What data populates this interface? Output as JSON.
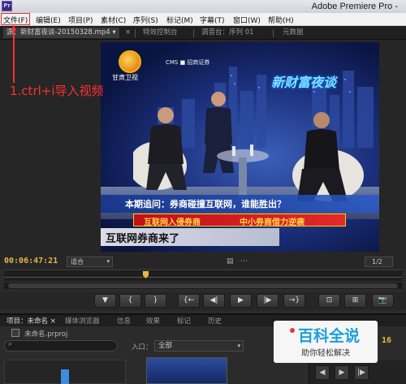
{
  "window": {
    "title": "Adobe Premiere Pro -",
    "app_badge": "Pr"
  },
  "menu": {
    "items": [
      "文件(F)",
      "编辑(E)",
      "项目(P)",
      "素材(C)",
      "序列(S)",
      "标记(M)",
      "字幕(T)",
      "窗口(W)",
      "帮助(H)"
    ]
  },
  "tabs": {
    "source": "源：新财富夜谈-20150328.mp4 ▾",
    "effects": "特效控制台",
    "mixer": "调音台：序列 01",
    "metadata": "元数据",
    "close": "×"
  },
  "video": {
    "station_logo": "甘肃卫视",
    "cms_text": "CMS  ■ 招商证券",
    "show_logo": "新财富夜谈",
    "caption_question": "本期追问：券商碰撞互联网，谁能胜出？",
    "caption_red_left": "互联网入侵券商",
    "caption_red_right": "中小券商借力逆袭",
    "caption_main": "互联网券商来了"
  },
  "annotation": {
    "text": "1.ctrl+i导入视频",
    "color": "#ff3030"
  },
  "monitor": {
    "timecode": "00:06:47:21",
    "fit": "适合",
    "resolution": "1/2",
    "dropdown_glyph": "▾"
  },
  "transport": {
    "buttons": [
      "▼",
      "{",
      "}",
      "{←",
      "◀|",
      "▶",
      "|▶",
      "→}",
      "⊡",
      "⊞",
      "📷"
    ]
  },
  "bottom_tabs": [
    "项目：未命名 ×",
    "媒体浏览器",
    "信息",
    "效果",
    "标记",
    "历史"
  ],
  "project": {
    "name": "未命名.prproj",
    "in_label": "入口：",
    "in_value": "全部",
    "search_glyph": "⌕"
  },
  "watermark": {
    "title": "百科全说",
    "subtitle": "助你轻松解决"
  },
  "side": {
    "timecode": "16",
    "buttons": [
      "◀",
      "▶",
      "|▶"
    ]
  },
  "colors": {
    "accent": "#e8b640",
    "annotation": "#ff3030"
  }
}
